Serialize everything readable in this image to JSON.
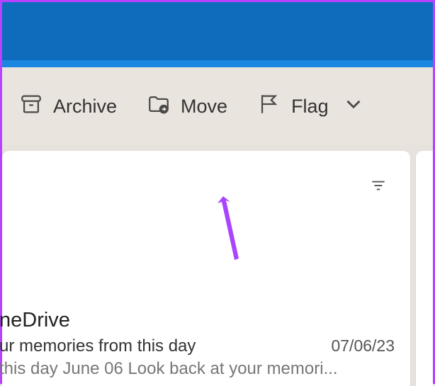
{
  "toolbar": {
    "archive_label": "Archive",
    "move_label": "Move",
    "flag_label": "Flag"
  },
  "email": {
    "sender": "neDrive",
    "subject": "ur memories from this day",
    "date": "07/06/23",
    "preview": " this day June 06 Look back at your memori..."
  }
}
